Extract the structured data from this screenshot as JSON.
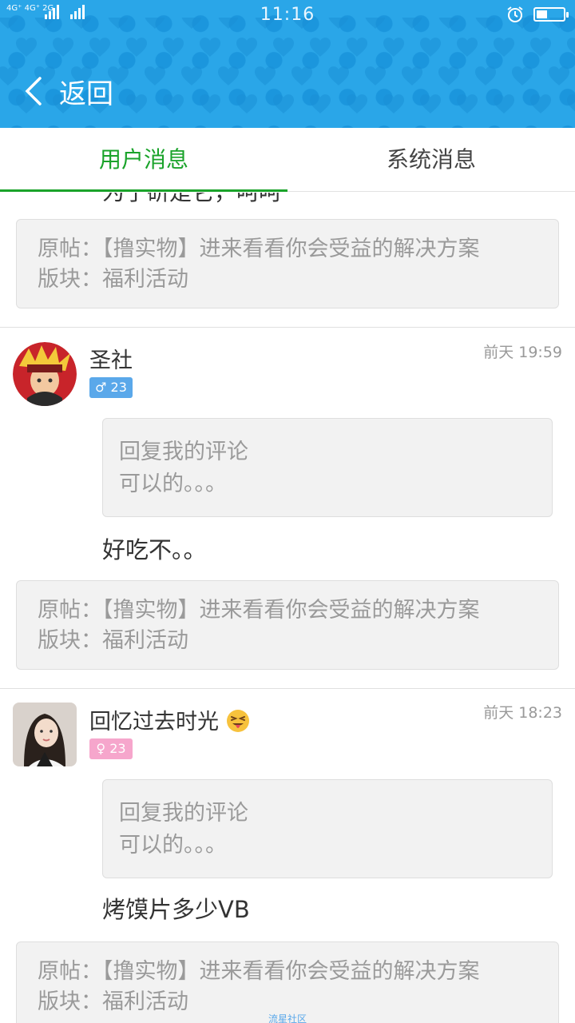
{
  "status": {
    "network_left": "4G⁺",
    "network_left2": "4G⁺",
    "network_sub": "2G",
    "network_right": "2G",
    "time": "11:16",
    "battery_level": 0.4
  },
  "header": {
    "back_label": "返回"
  },
  "tabs": [
    {
      "label": "用户消息",
      "active": true
    },
    {
      "label": "系统消息",
      "active": false
    }
  ],
  "cut_text": "为了研是它，呵呵",
  "messages": [
    {
      "orig_post": "原帖：【撸实物】进来看看你会受益的解决方案",
      "board": "版块：福利活动"
    },
    {
      "user": "圣社",
      "gender_symbol": "♂",
      "age": "23",
      "time": "前天 19:59",
      "reply_line1": "回复我的评论",
      "reply_line2": "可以的。。。",
      "comment": "好吃不。。",
      "orig_post": "原帖：【撸实物】进来看看你会受益的解决方案",
      "board": "版块：福利活动"
    },
    {
      "user": "回忆过去时光",
      "gender_symbol": "♀",
      "age": "23",
      "time": "前天 18:23",
      "reply_line1": "回复我的评论",
      "reply_line2": "可以的。。。",
      "comment": "烤馍片多少VB",
      "orig_post": "原帖：【撸实物】进来看看你会受益的解决方案",
      "board": "版块：福利活动"
    }
  ],
  "watermark": "流星社区",
  "colors": {
    "header": "#2aa6e8",
    "tab_active": "#1aa32a",
    "male": "#5aa8ea",
    "female": "#f6a6cc"
  }
}
